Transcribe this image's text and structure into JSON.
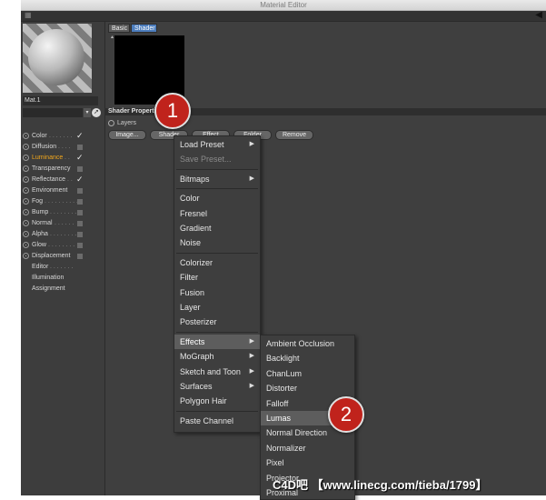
{
  "window": {
    "title": "Material Editor"
  },
  "material": {
    "name": "Mat.1"
  },
  "channels": [
    {
      "label": "Color",
      "dots": ". . . . . . .",
      "state": "checked"
    },
    {
      "label": "Diffusion",
      "dots": ". . . .",
      "state": "box"
    },
    {
      "label": "Luminance",
      "dots": ". .",
      "state": "checked",
      "active": true
    },
    {
      "label": "Transparency",
      "dots": "",
      "state": "box"
    },
    {
      "label": "Reflectance",
      "dots": ". .",
      "state": "checked"
    },
    {
      "label": "Environment",
      "dots": "",
      "state": "box"
    },
    {
      "label": "Fog",
      "dots": ". . . . . . . . . .",
      "state": "box"
    },
    {
      "label": "Bump",
      "dots": ". . . . . . . .",
      "state": "box"
    },
    {
      "label": "Normal",
      "dots": ". . . . . .",
      "state": "box"
    },
    {
      "label": "Alpha",
      "dots": ". . . . . . . .",
      "state": "box"
    },
    {
      "label": "Glow",
      "dots": ". . . . . . . .",
      "state": "box"
    },
    {
      "label": "Displacement",
      "dots": "",
      "state": "box"
    }
  ],
  "extra_items": [
    {
      "label": "Editor",
      "dots": ". . . . . . ."
    },
    {
      "label": "Illumination",
      "dots": ""
    },
    {
      "label": "Assignment",
      "dots": ""
    }
  ],
  "tabs": [
    "Basic",
    "Shader"
  ],
  "section": {
    "title": "Shader Properties"
  },
  "layers_label": "Layers",
  "buttons": [
    "Image...",
    "Shader",
    "Effect",
    "Folder",
    "Remove"
  ],
  "shader_menu": [
    {
      "label": "Load Preset",
      "sub": true
    },
    {
      "label": "Save Preset...",
      "disabled": true
    },
    {
      "sep": true
    },
    {
      "label": "Bitmaps",
      "sub": true
    },
    {
      "sep": true
    },
    {
      "label": "Color"
    },
    {
      "label": "Fresnel"
    },
    {
      "label": "Gradient"
    },
    {
      "label": "Noise"
    },
    {
      "sep": true
    },
    {
      "label": "Colorizer"
    },
    {
      "label": "Filter"
    },
    {
      "label": "Fusion"
    },
    {
      "label": "Layer"
    },
    {
      "label": "Posterizer"
    },
    {
      "sep": true
    },
    {
      "label": "Effects",
      "sub": true,
      "highlight": true
    },
    {
      "label": "MoGraph",
      "sub": true
    },
    {
      "label": "Sketch and Toon",
      "sub": true
    },
    {
      "label": "Surfaces",
      "sub": true
    },
    {
      "label": "Polygon Hair"
    },
    {
      "sep": true
    },
    {
      "label": "Paste Channel"
    }
  ],
  "effects_menu": [
    {
      "label": "Ambient Occlusion"
    },
    {
      "label": "Backlight"
    },
    {
      "label": "ChanLum"
    },
    {
      "label": "Distorter"
    },
    {
      "label": "Falloff"
    },
    {
      "label": "Lumas",
      "highlight": true
    },
    {
      "label": "Normal Direction"
    },
    {
      "label": "Normalizer"
    },
    {
      "label": "Pixel"
    },
    {
      "label": "Projector"
    },
    {
      "label": "Proximal"
    }
  ],
  "badges": [
    "1",
    "2"
  ],
  "watermark": "C4D吧 【www.linecg.com/tieba/1799】",
  "icons": {
    "grid": "grid-icon",
    "collapse": "triangle-left-icon",
    "cursor": "cursor-icon"
  }
}
